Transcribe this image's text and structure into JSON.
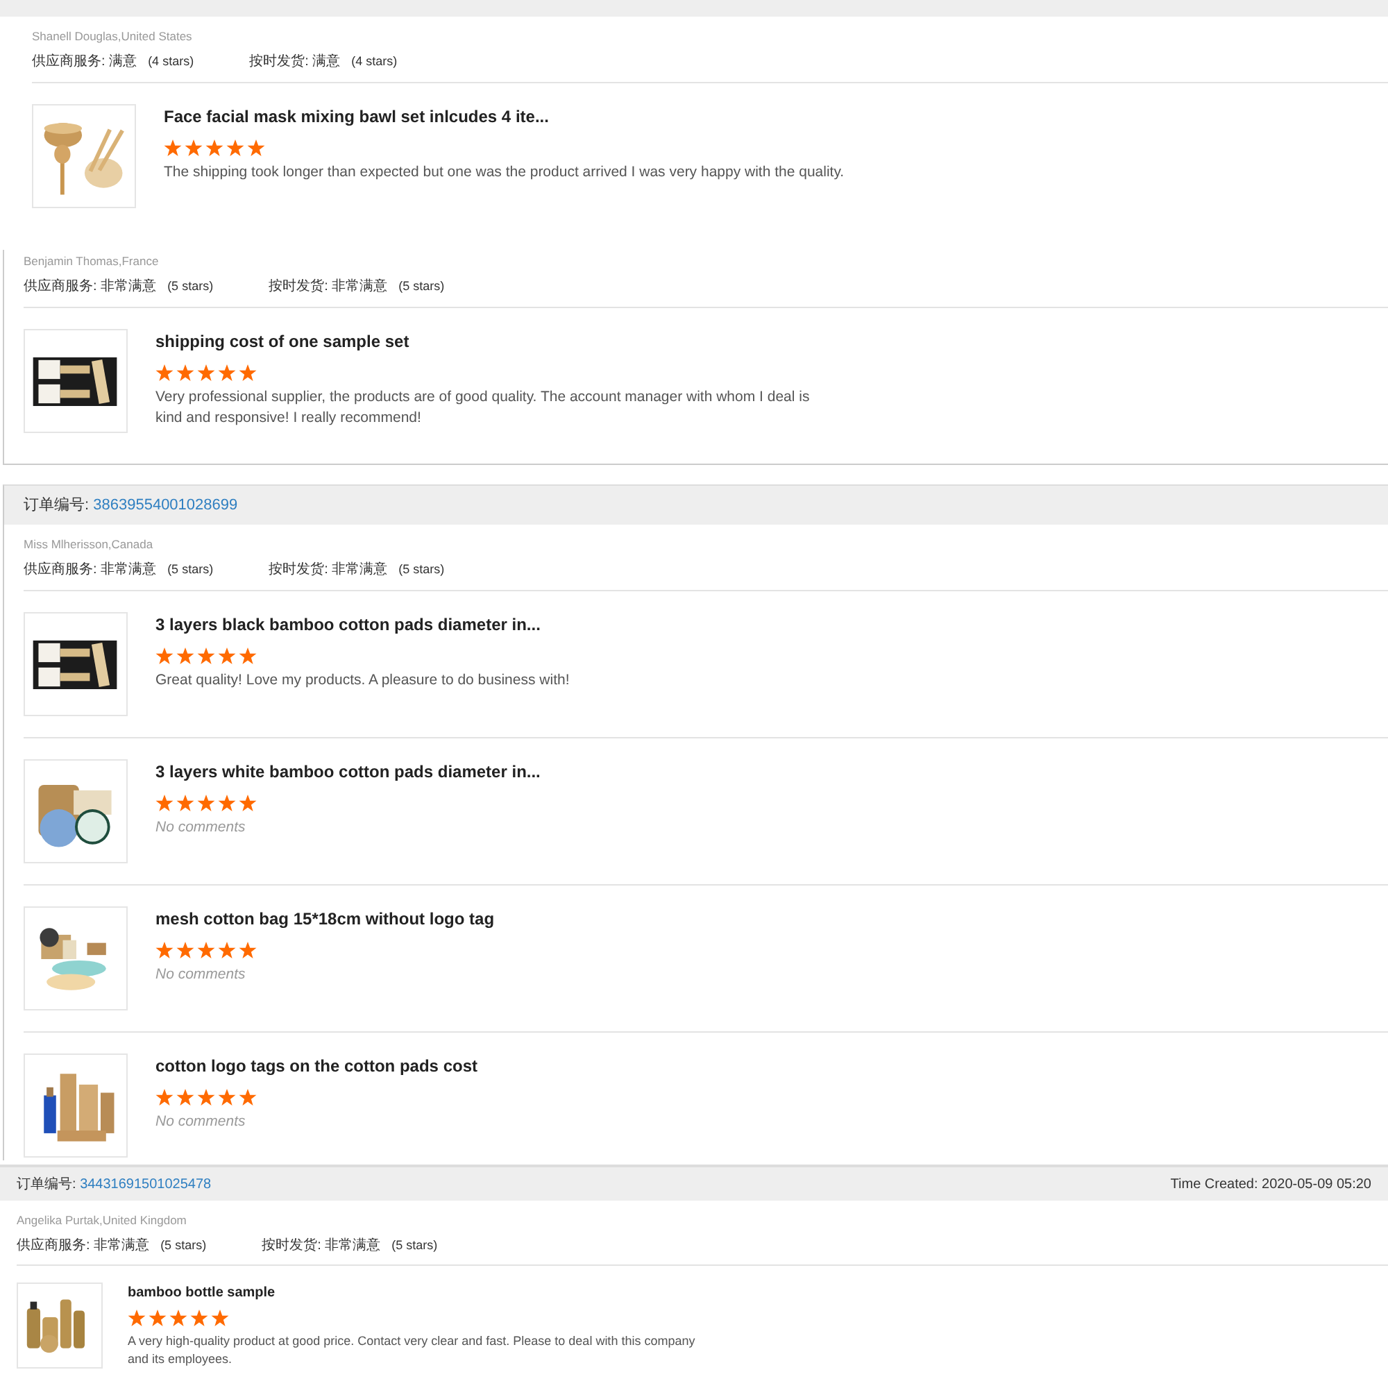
{
  "orders": [
    {
      "reviewer": "Shanell Douglas,United States",
      "ratings": [
        {
          "text": "供应商服务: 满意",
          "note": "(4 stars)"
        },
        {
          "text": "按时发货: 满意",
          "note": "(4 stars)"
        }
      ],
      "items": [
        {
          "title": "Face facial mask mixing bawl set inlcudes 4 ite...",
          "stars": 5,
          "comment": "The shipping took longer than expected but one was the product arrived I was very happy with the quality.",
          "no_comment": false
        }
      ]
    },
    {
      "reviewer": "Benjamin Thomas,France",
      "ratings": [
        {
          "text": "供应商服务: 非常满意",
          "note": "(5 stars)"
        },
        {
          "text": "按时发货: 非常满意",
          "note": "(5 stars)"
        }
      ],
      "items": [
        {
          "title": "shipping cost of one sample set",
          "stars": 5,
          "comment": "Very professional supplier, the products are of good quality. The account manager with whom I deal is kind and responsive! I really recommend!",
          "no_comment": false
        }
      ]
    },
    {
      "order_label": "订单编号:",
      "order_number": "38639554001028699",
      "reviewer": "Miss Mlherisson,Canada",
      "ratings": [
        {
          "text": "供应商服务: 非常满意",
          "note": "(5 stars)"
        },
        {
          "text": "按时发货: 非常满意",
          "note": "(5 stars)"
        }
      ],
      "items": [
        {
          "title": "3 layers black bamboo cotton pads diameter in...",
          "stars": 5,
          "comment": "Great quality! Love my products. A pleasure to do business with!",
          "no_comment": false
        },
        {
          "title": "3 layers white bamboo cotton pads diameter in...",
          "stars": 5,
          "comment": "No comments",
          "no_comment": true
        },
        {
          "title": "mesh cotton bag 15*18cm without logo tag",
          "stars": 5,
          "comment": "No comments",
          "no_comment": true
        },
        {
          "title": "cotton logo tags on the cotton pads cost",
          "stars": 5,
          "comment": "No comments",
          "no_comment": true
        }
      ]
    },
    {
      "order_label": "订单编号:",
      "order_number": "34431691501025478",
      "time_created": "Time Created: 2020-05-09 05:20",
      "reviewer": "Angelika Purtak,United Kingdom",
      "ratings": [
        {
          "text": "供应商服务: 非常满意",
          "note": "(5 stars)"
        },
        {
          "text": "按时发货: 非常满意",
          "note": "(5 stars)"
        }
      ],
      "items": [
        {
          "title": "bamboo bottle sample",
          "stars": 5,
          "comment": "A very high-quality product at good price. Contact very clear and fast. Please to deal with this company and its employees.",
          "no_comment": false
        }
      ]
    }
  ]
}
